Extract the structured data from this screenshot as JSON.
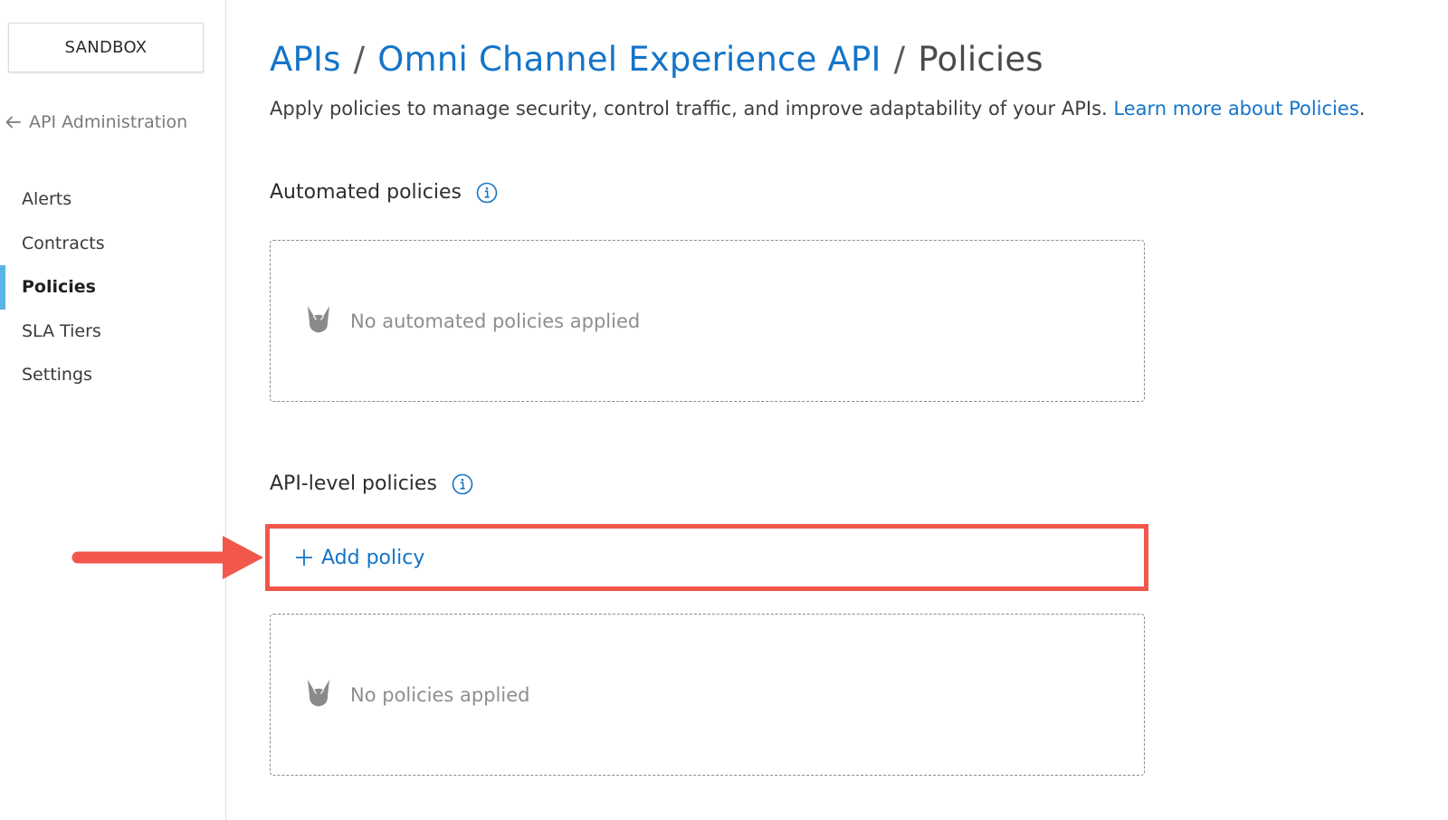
{
  "sidebar": {
    "environment_label": "SANDBOX",
    "back_link": "API Administration",
    "items": [
      {
        "label": "Alerts",
        "active": false
      },
      {
        "label": "Contracts",
        "active": false
      },
      {
        "label": "Policies",
        "active": true
      },
      {
        "label": "SLA Tiers",
        "active": false
      },
      {
        "label": "Settings",
        "active": false
      }
    ]
  },
  "header": {
    "breadcrumb": [
      "APIs",
      "Omni Channel Experience API",
      "Policies"
    ],
    "separator": "/",
    "description": "Apply policies to manage security, control traffic, and improve adaptability of your APIs.",
    "learn_more_link": "Learn more about Policies",
    "description_end": "."
  },
  "sections": {
    "automated": {
      "title": "Automated policies",
      "empty_text": "No automated policies applied"
    },
    "api_level": {
      "title": "API-level policies",
      "add_button": "Add policy",
      "empty_text": "No policies applied"
    }
  },
  "icons": {
    "back": "arrow-left-icon",
    "info": "info-icon",
    "empty": "empty-state-icon",
    "plus": "plus-icon"
  },
  "colors": {
    "link": "#1474c8",
    "active_indicator": "#5ab4e5",
    "highlight": "#f1574b"
  }
}
